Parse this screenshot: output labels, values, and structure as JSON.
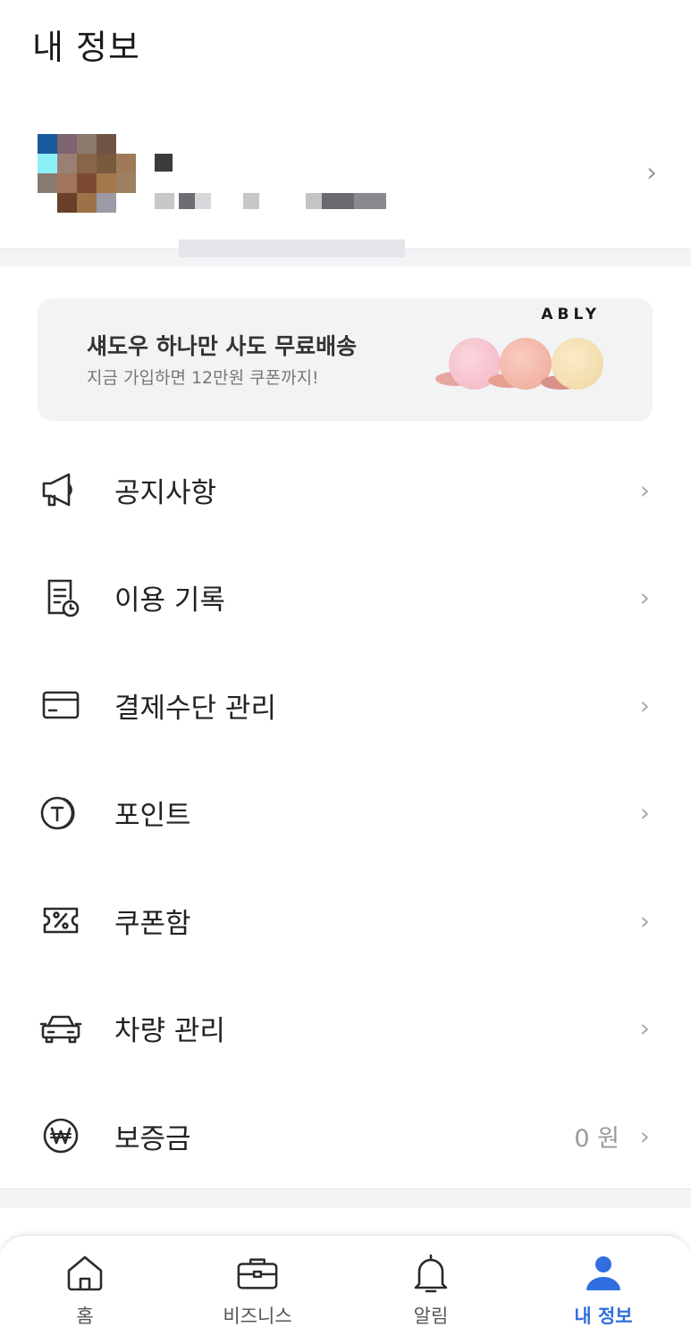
{
  "header": {
    "title": "내 정보"
  },
  "profile": {
    "chevron": "›",
    "avatar_pixels": [
      "#1a5a9c",
      "#7d6470",
      "#8a7a6a",
      "#6e5444",
      "#ffffff",
      "#8df0f6",
      "#9a7f74",
      "#8a6448",
      "#7a5a3e",
      "#a07a58",
      "#8a7a72",
      "#a2745a",
      "#7c4a34",
      "#a4784c",
      "#9c8060",
      "#ffffff",
      "#6a4028",
      "#9c7248",
      "#9c9aa4",
      "#ffffff"
    ]
  },
  "banner": {
    "title": "섀도우 하나만 사도 무료배송",
    "subtitle": "지금 가입하면 12만원 쿠폰까지!",
    "brand": "ABLY",
    "colors": {
      "pan1": "#f4bcc8",
      "pan2": "#f3b0a4",
      "pan3": "#f2dcaa"
    }
  },
  "menu": {
    "items": [
      {
        "label": "공지사항",
        "icon": "megaphone-icon",
        "value": ""
      },
      {
        "label": "이용 기록",
        "icon": "history-document-icon",
        "value": ""
      },
      {
        "label": "결제수단 관리",
        "icon": "credit-card-icon",
        "value": ""
      },
      {
        "label": "포인트",
        "icon": "point-coin-icon",
        "value": ""
      },
      {
        "label": "쿠폰함",
        "icon": "coupon-icon",
        "value": ""
      },
      {
        "label": "차량 관리",
        "icon": "car-icon",
        "value": ""
      },
      {
        "label": "보증금",
        "icon": "won-coin-icon",
        "value": "0 원"
      }
    ],
    "chevron": "›"
  },
  "tabbar": {
    "tabs": [
      {
        "label": "홈",
        "icon": "home-icon",
        "active": false
      },
      {
        "label": "비즈니스",
        "icon": "briefcase-icon",
        "active": false
      },
      {
        "label": "알림",
        "icon": "bell-icon",
        "active": false
      },
      {
        "label": "내 정보",
        "icon": "person-icon",
        "active": true
      }
    ],
    "active_color": "#2f6fe0"
  }
}
